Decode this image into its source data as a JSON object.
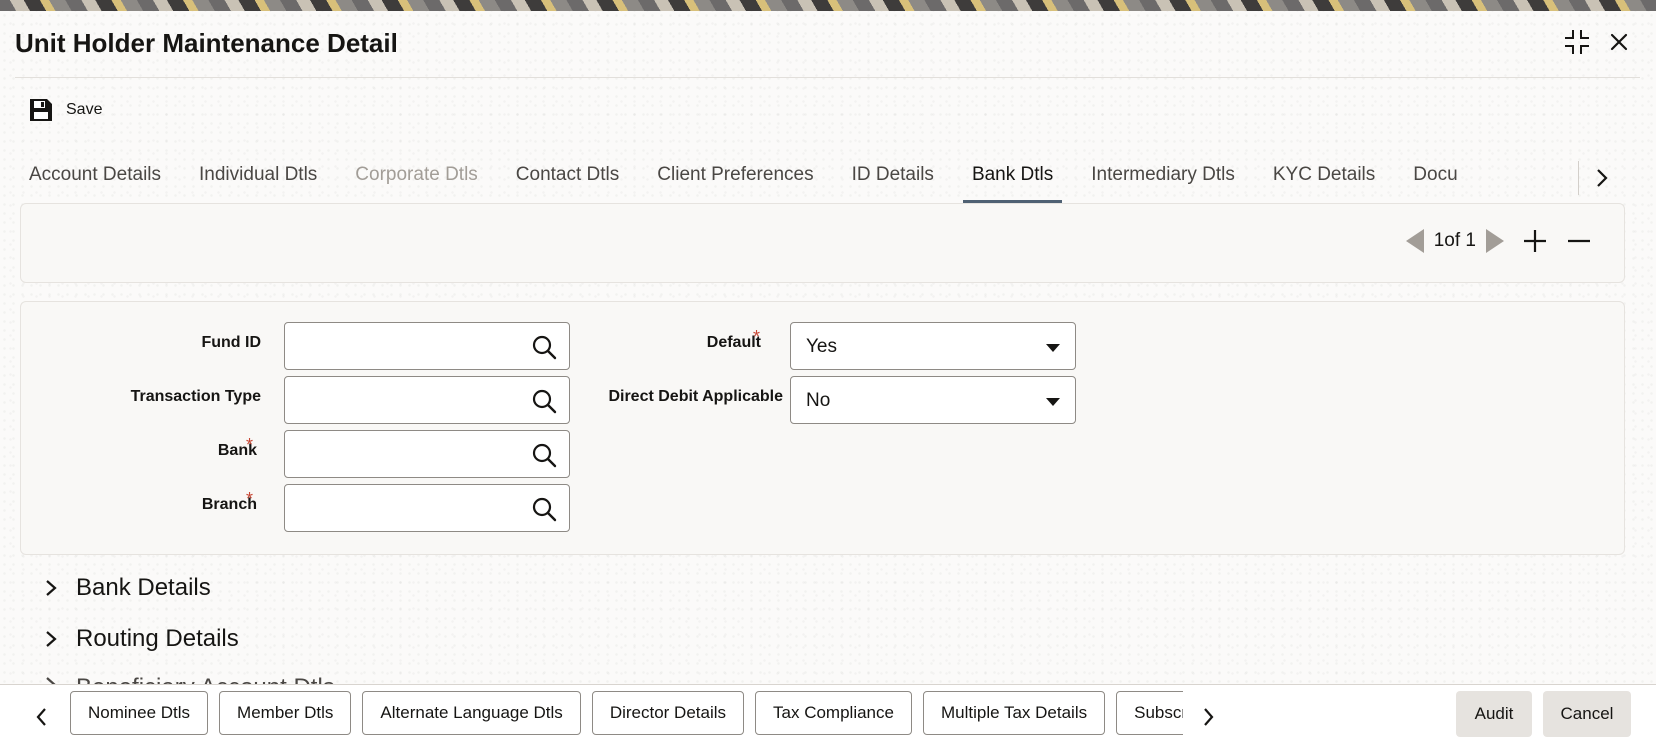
{
  "window": {
    "title": "Unit Holder Maintenance Detail"
  },
  "toolbar": {
    "save_label": "Save"
  },
  "tabs": [
    {
      "label": "Account Details",
      "state": "normal"
    },
    {
      "label": "Individual Dtls",
      "state": "normal"
    },
    {
      "label": "Corporate Dtls",
      "state": "disabled"
    },
    {
      "label": "Contact Dtls",
      "state": "normal"
    },
    {
      "label": "Client Preferences",
      "state": "normal"
    },
    {
      "label": "ID Details",
      "state": "normal"
    },
    {
      "label": "Bank Dtls",
      "state": "active"
    },
    {
      "label": "Intermediary Dtls",
      "state": "normal"
    },
    {
      "label": "KYC Details",
      "state": "normal"
    },
    {
      "label": "Docu",
      "state": "normal"
    }
  ],
  "pager": {
    "text": "1of 1"
  },
  "form": {
    "fund_id": {
      "label": "Fund ID",
      "value": ""
    },
    "transaction_type": {
      "label": "Transaction Type",
      "value": ""
    },
    "bank": {
      "label": "Bank",
      "value": ""
    },
    "branch": {
      "label": "Branch",
      "value": ""
    },
    "default": {
      "label": "Default",
      "value": "Yes"
    },
    "direct_debit": {
      "label": "Direct Debit Applicable",
      "value": "No"
    },
    "required_marker": "*"
  },
  "sections": [
    {
      "label": "Bank Details"
    },
    {
      "label": "Routing Details"
    },
    {
      "label": "Beneficiary Account Dtls"
    }
  ],
  "footer": {
    "tabs": [
      {
        "label": "Nominee Dtls"
      },
      {
        "label": "Member Dtls"
      },
      {
        "label": "Alternate Language Dtls"
      },
      {
        "label": "Director Details"
      },
      {
        "label": "Tax Compliance"
      },
      {
        "label": "Multiple Tax Details"
      },
      {
        "label": "Subscr"
      }
    ],
    "audit_label": "Audit",
    "cancel_label": "Cancel"
  },
  "colors": {
    "accent_underline": "#4f6173",
    "required": "#c74634",
    "action_button_bg": "#e6e3df"
  }
}
